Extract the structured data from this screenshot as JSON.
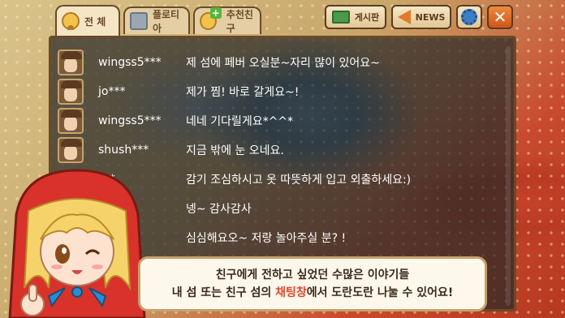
{
  "tabs": [
    {
      "label": "전 체",
      "active": true,
      "icon": "smiley-avatar-icon"
    },
    {
      "label": "플로티아",
      "active": false,
      "icon": "person-card-icon"
    },
    {
      "label": "추천친구",
      "active": false,
      "icon": "add-friend-icon"
    }
  ],
  "toolbar": {
    "board_label": "게시판",
    "news_label": "NEWS",
    "settings_icon": "gear-icon",
    "close_label": "✕"
  },
  "messages": [
    {
      "user": "wingss5***",
      "text": "제 섬에 페버 오실분~자리 많이 있어요~"
    },
    {
      "user": "jo***",
      "text": "제가 찜! 바로 갈게요~!"
    },
    {
      "user": "wingss5***",
      "text": "네네 기다릴게요*^^*"
    },
    {
      "user": "shush***",
      "text": "지금 밖에 눈 오네요."
    },
    {
      "user": "***",
      "text": "감기 조심하시고 옷 따뜻하게 입고 외출하세요:)"
    },
    {
      "user": "",
      "text": "넹~ 감사감사"
    },
    {
      "user": "",
      "text": "심심해요오~ 저랑 놀아주실 분? !"
    }
  ],
  "bubble": {
    "line1": "친구에게 전하고 싶었던 수많은 이야기들",
    "line2_pre": "내 섬 또는 친구 섬의 ",
    "line2_highlight": "채팅창",
    "line2_post": "에서 도란도란 나눌 수 있어요!"
  },
  "colors": {
    "accent": "#e0462a",
    "panel": "#6b4a2a"
  }
}
